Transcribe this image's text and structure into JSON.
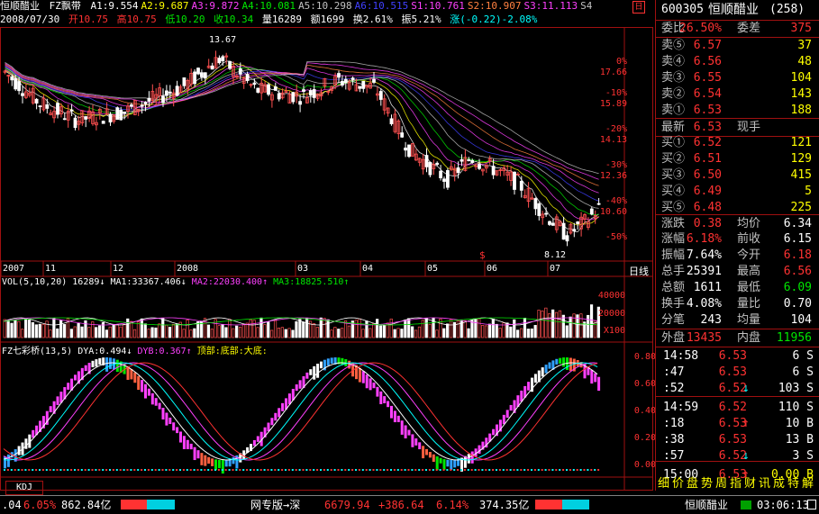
{
  "header": {
    "stock_name": "恒顺醋业",
    "indicator_name": "FZ飘带",
    "levels": [
      {
        "label": "A1:9.554",
        "color": "#ffffff"
      },
      {
        "label": "A2:9.687",
        "color": "#ffff00"
      },
      {
        "label": "A3:9.872",
        "color": "#ff40ff"
      },
      {
        "label": "A4:10.081",
        "color": "#00e600"
      },
      {
        "label": "A5:10.298",
        "color": "#c0c0c0"
      },
      {
        "label": "A6:10.515",
        "color": "#4040ff"
      },
      {
        "label": "S1:10.761",
        "color": "#ff40ff"
      },
      {
        "label": "S2:10.907",
        "color": "#ff8040"
      },
      {
        "label": "S3:11.113",
        "color": "#ff40ff"
      },
      {
        "label": "S4",
        "color": "#c0c0c0"
      }
    ],
    "right_icon": "日"
  },
  "daily": {
    "date": "2008/07/30",
    "open": "开10.75",
    "high": "高10.75",
    "low": "低10.20",
    "close": "收10.34",
    "volume": "量16289",
    "amount": "额1699",
    "turnover": "换2.61%",
    "amplitude": "振5.21%",
    "change": "涨(-0.22)-2.08%"
  },
  "price_chart": {
    "high_label": "13.67",
    "low_label": "8.12",
    "marker": "$",
    "y_labels": [
      {
        "pct": "0%",
        "price": "17.66"
      },
      {
        "pct": "-10%",
        "price": "15.89"
      },
      {
        "pct": "-20%",
        "price": "14.13"
      },
      {
        "pct": "-30%",
        "price": "12.36"
      },
      {
        "pct": "-40%",
        "price": "10.60"
      },
      {
        "pct": "-50%",
        "price": ""
      }
    ],
    "x_labels": [
      "2007",
      "11",
      "12",
      "2008",
      "03",
      "04",
      "05",
      "06",
      "07"
    ],
    "period": "日线"
  },
  "volume_chart": {
    "title": "VOL(5,10,20)",
    "vol": "16289",
    "ma1": "MA1:33367.406",
    "ma2": "MA2:22030.400",
    "ma3": "MA3:18825.510",
    "y_labels": [
      "40000",
      "20000",
      "X100"
    ]
  },
  "osc_chart": {
    "title": "FZ七彩桥(13,5)",
    "dya": "DYA:0.494",
    "dyb": "DYB:0.367",
    "note": "顶部:底部:大底:",
    "y_labels": [
      "0.80",
      "0.60",
      "0.40",
      "0.20",
      "0.00"
    ]
  },
  "bottom_tab": "KDJ",
  "quote": {
    "code": "600305",
    "name": "恒顺醋业",
    "badge": "(258)",
    "weibi_label": "委比",
    "weibi": "26.50%",
    "weicha_label": "委差",
    "weicha": "375",
    "sells": [
      {
        "label": "卖⑤",
        "price": "6.57",
        "vol": "37"
      },
      {
        "label": "卖④",
        "price": "6.56",
        "vol": "48"
      },
      {
        "label": "卖③",
        "price": "6.55",
        "vol": "104"
      },
      {
        "label": "卖②",
        "price": "6.54",
        "vol": "143"
      },
      {
        "label": "卖①",
        "price": "6.53",
        "vol": "188"
      }
    ],
    "last_label": "最新",
    "last": "6.53",
    "hand_label": "现手",
    "buys": [
      {
        "label": "买①",
        "price": "6.52",
        "vol": "121"
      },
      {
        "label": "买②",
        "price": "6.51",
        "vol": "129"
      },
      {
        "label": "买③",
        "price": "6.50",
        "vol": "415"
      },
      {
        "label": "买④",
        "price": "6.49",
        "vol": "5"
      },
      {
        "label": "买⑤",
        "price": "6.48",
        "vol": "225"
      }
    ],
    "stats": [
      {
        "l1": "涨跌",
        "v1": "0.38",
        "l2": "均价",
        "v2": "6.34",
        "c1": "#ff3232",
        "c2": "#ffffff"
      },
      {
        "l1": "涨幅",
        "v1": "6.18%",
        "l2": "前收",
        "v2": "6.15",
        "c1": "#ff3232",
        "c2": "#ffffff"
      },
      {
        "l1": "振幅",
        "v1": "7.64%",
        "l2": "今开",
        "v2": "6.18",
        "c1": "#ffffff",
        "c2": "#ff3232"
      },
      {
        "l1": "总手",
        "v1": "25391",
        "l2": "最高",
        "v2": "6.56",
        "c1": "#ffffff",
        "c2": "#ff3232"
      },
      {
        "l1": "总额",
        "v1": "1611",
        "l2": "最低",
        "v2": "6.09",
        "c1": "#ffffff",
        "c2": "#00e600"
      },
      {
        "l1": "换手",
        "v1": "4.08%",
        "l2": "量比",
        "v2": "0.70",
        "c1": "#ffffff",
        "c2": "#ffffff"
      },
      {
        "l1": "分笔",
        "v1": "243",
        "l2": "均量",
        "v2": "104",
        "c1": "#ffffff",
        "c2": "#ffffff"
      }
    ],
    "outer_label": "外盘",
    "outer": "13435",
    "inner_label": "内盘",
    "inner": "11956",
    "ticks": [
      {
        "time": "14:58",
        "price": "6.53",
        "vol": "6 S",
        "arrow": "",
        "pc": "#ff3232",
        "vc": "#ffffff"
      },
      {
        "time": ":47",
        "price": "6.53",
        "vol": "6 S",
        "arrow": "",
        "pc": "#ff3232",
        "vc": "#ffffff"
      },
      {
        "time": ":52",
        "price": "6.52",
        "vol": "103 S",
        "arrow": "↓",
        "pc": "#ff3232",
        "vc": "#ffffff"
      },
      {
        "time": "14:59",
        "price": "6.52",
        "vol": "110 S",
        "arrow": "",
        "pc": "#ff3232",
        "vc": "#ffffff"
      },
      {
        "time": ":18",
        "price": "6.53",
        "vol": "10 B",
        "arrow": "↑",
        "pc": "#ff3232",
        "vc": "#ffffff"
      },
      {
        "time": ":38",
        "price": "6.53",
        "vol": "13 B",
        "arrow": "",
        "pc": "#ff3232",
        "vc": "#ffffff"
      },
      {
        "time": ":57",
        "price": "6.52",
        "vol": "3 S",
        "arrow": "↓",
        "pc": "#ff3232",
        "vc": "#ffffff"
      },
      {
        "time": "15:00",
        "price": "6.53",
        "vol": "0.00 B",
        "arrow": "↑",
        "pc": "#ff3232",
        "vc": "#ffff00"
      }
    ],
    "tabs": [
      "细",
      "价",
      "盘",
      "势",
      "周",
      "指",
      "财",
      "讯",
      "成",
      "特",
      "解"
    ]
  },
  "statusbar": {
    "left_change": ".04",
    "left_pct": "6.05%",
    "left_amount": "862.84亿",
    "center_label": "网专版→深",
    "center_index": "6679.94",
    "center_change": "+386.64",
    "center_pct": "6.14%",
    "center_amount": "374.35亿",
    "right_name": "恒顺醋业",
    "time": "03:06:13"
  }
}
